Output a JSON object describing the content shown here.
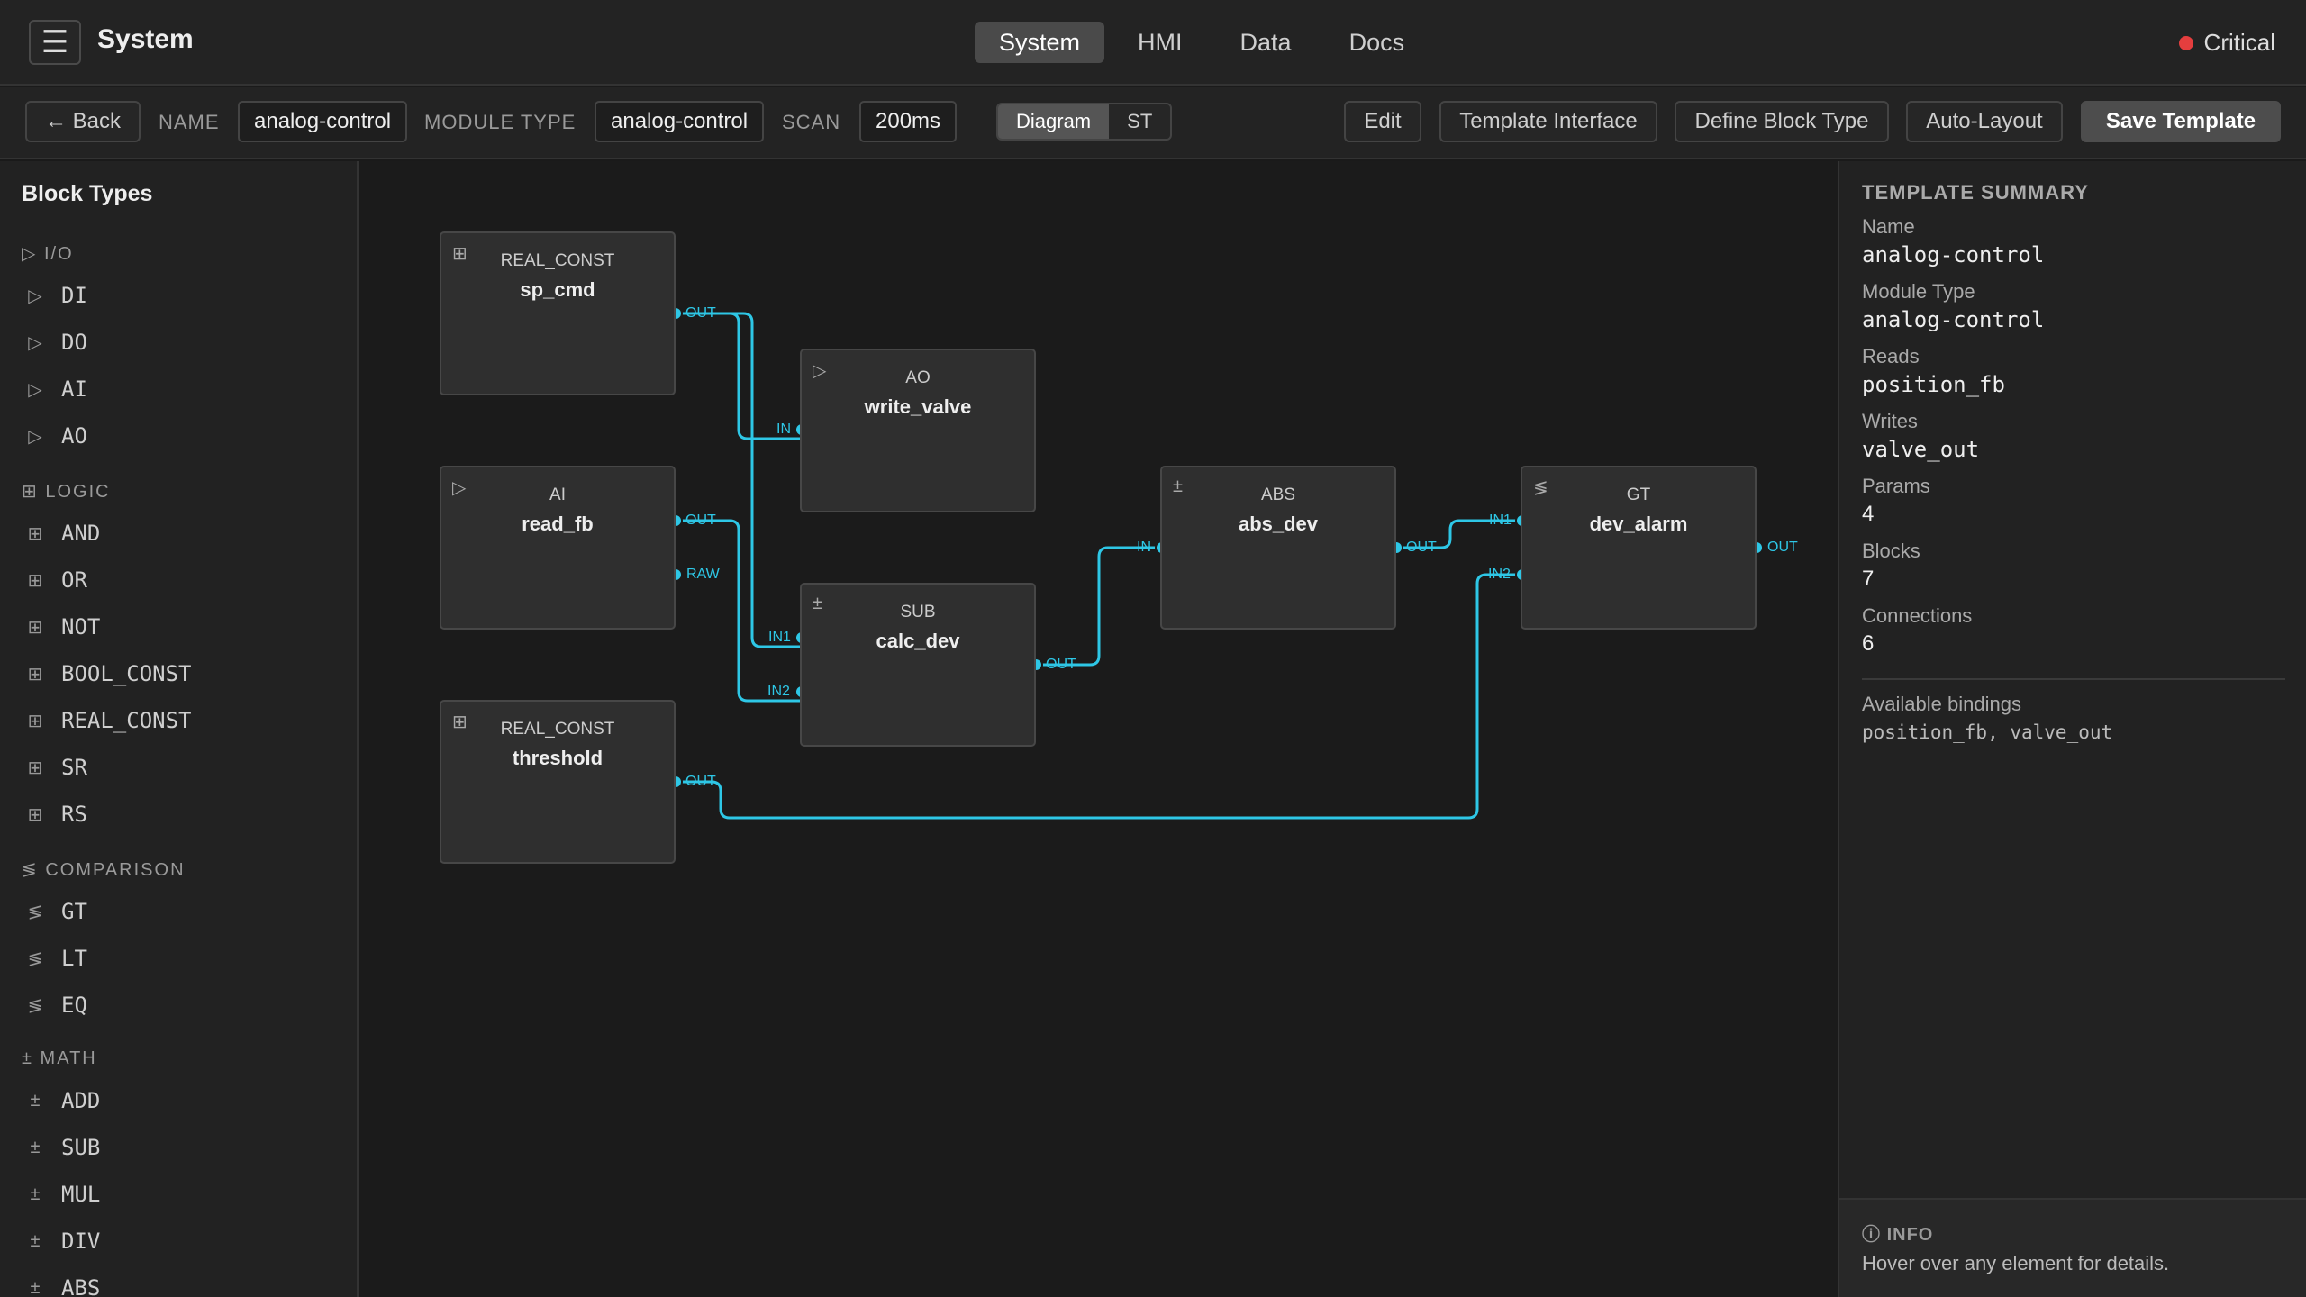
{
  "app": {
    "title": "System",
    "status": "Critical",
    "status_color": "#e53e3e"
  },
  "nav": {
    "tabs": [
      "System",
      "HMI",
      "Data",
      "Docs"
    ],
    "active": "System"
  },
  "toolbar": {
    "back": "← Back",
    "name_label": "NAME",
    "name_value": "analog-control",
    "module_type_label": "MODULE TYPE",
    "module_type_value": "analog-control",
    "scan_label": "SCAN",
    "scan_value": "200ms",
    "view_options": [
      "Diagram",
      "ST"
    ],
    "active_view": "Diagram",
    "edit": "Edit",
    "template_interface": "Template Interface",
    "define_block_type": "Define Block Type",
    "auto_layout": "Auto-Layout",
    "save_template": "Save Template"
  },
  "sidebar": {
    "title": "Block Types",
    "categories": [
      {
        "name": "I/O",
        "icon": "▷",
        "items": [
          "DI",
          "DO",
          "AI",
          "AO"
        ]
      },
      {
        "name": "LOGIC",
        "icon": "⊞",
        "items": [
          "AND",
          "OR",
          "NOT",
          "BOOL_CONST",
          "REAL_CONST",
          "SR",
          "RS"
        ]
      },
      {
        "name": "COMPARISON",
        "icon": "≶",
        "items": [
          "GT",
          "LT",
          "EQ"
        ]
      },
      {
        "name": "MATH",
        "icon": "±",
        "items": [
          "ADD",
          "SUB",
          "MUL",
          "DIV",
          "ABS"
        ]
      }
    ]
  },
  "diagram": {
    "wire_color": "#2ec7e6",
    "blocks": [
      {
        "id": "sp_cmd",
        "type": "REAL_CONST",
        "name": "sp_cmd",
        "icon": "⊞",
        "outputs": [
          "OUT"
        ],
        "inputs": []
      },
      {
        "id": "write_valve",
        "type": "AO",
        "name": "write_valve",
        "icon": "▷",
        "inputs": [
          "IN"
        ],
        "outputs": []
      },
      {
        "id": "read_fb",
        "type": "AI",
        "name": "read_fb",
        "icon": "▷",
        "inputs": [],
        "outputs": [
          "OUT",
          "RAW"
        ]
      },
      {
        "id": "calc_dev",
        "type": "SUB",
        "name": "calc_dev",
        "icon": "±",
        "inputs": [
          "IN1",
          "IN2"
        ],
        "outputs": [
          "OUT"
        ]
      },
      {
        "id": "threshold",
        "type": "REAL_CONST",
        "name": "threshold",
        "icon": "⊞",
        "inputs": [],
        "outputs": [
          "OUT"
        ]
      },
      {
        "id": "abs_dev",
        "type": "ABS",
        "name": "abs_dev",
        "icon": "±",
        "inputs": [
          "IN"
        ],
        "outputs": [
          "OUT"
        ]
      },
      {
        "id": "dev_alarm",
        "type": "GT",
        "name": "dev_alarm",
        "icon": "≶",
        "inputs": [
          "IN1",
          "IN2"
        ],
        "outputs": [
          "OUT"
        ]
      }
    ],
    "connections": [
      {
        "from": "sp_cmd.OUT",
        "to": "write_valve.IN"
      },
      {
        "from": "sp_cmd.OUT",
        "to": "calc_dev.IN1"
      },
      {
        "from": "read_fb.OUT",
        "to": "calc_dev.IN2"
      },
      {
        "from": "calc_dev.OUT",
        "to": "abs_dev.IN"
      },
      {
        "from": "abs_dev.OUT",
        "to": "dev_alarm.IN1"
      },
      {
        "from": "threshold.OUT",
        "to": "dev_alarm.IN2"
      }
    ]
  },
  "summary": {
    "title": "TEMPLATE SUMMARY",
    "fields": [
      {
        "label": "Name",
        "value": "analog-control",
        "mono": true
      },
      {
        "label": "Module Type",
        "value": "analog-control",
        "mono": true
      },
      {
        "label": "Reads",
        "value": "position_fb",
        "mono": true
      },
      {
        "label": "Writes",
        "value": "valve_out",
        "mono": true
      },
      {
        "label": "Params",
        "value": "4",
        "mono": false
      },
      {
        "label": "Blocks",
        "value": "7",
        "mono": false
      },
      {
        "label": "Connections",
        "value": "6",
        "mono": false
      }
    ],
    "bindings_label": "Available bindings",
    "bindings_value": "position_fb, valve_out"
  },
  "info": {
    "title": "INFO",
    "text": "Hover over any element for details."
  }
}
